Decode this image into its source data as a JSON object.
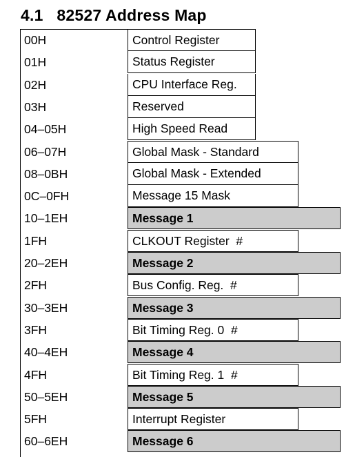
{
  "section": {
    "number": "4.1",
    "title": "82527 Address Map"
  },
  "rows": [
    {
      "address": "00H",
      "name": "Control Register",
      "kind": "narrow"
    },
    {
      "address": "01H",
      "name": "Status Register",
      "kind": "narrow"
    },
    {
      "address": "02H",
      "name": "CPU Interface Reg.",
      "kind": "narrow"
    },
    {
      "address": "03H",
      "name": "Reserved",
      "kind": "narrow"
    },
    {
      "address": "04–05H",
      "name": "High Speed Read",
      "kind": "narrow"
    },
    {
      "address": "06–07H",
      "name": "Global Mask - Standard",
      "kind": "medium"
    },
    {
      "address": "08–0BH",
      "name": "Global Mask - Extended",
      "kind": "medium"
    },
    {
      "address": "0C–0FH",
      "name": "Message 15 Mask",
      "kind": "medium"
    },
    {
      "address": "10–1EH",
      "name": "Message 1",
      "kind": "message"
    },
    {
      "address": "1FH",
      "name": "CLKOUT Register  #",
      "kind": "medium"
    },
    {
      "address": "20–2EH",
      "name": "Message 2",
      "kind": "message"
    },
    {
      "address": "2FH",
      "name": "Bus Config. Reg.  #",
      "kind": "medium"
    },
    {
      "address": "30–3EH",
      "name": "Message 3",
      "kind": "message"
    },
    {
      "address": "3FH",
      "name": "Bit Timing Reg. 0  #",
      "kind": "medium"
    },
    {
      "address": "40–4EH",
      "name": "Message 4",
      "kind": "message"
    },
    {
      "address": "4FH",
      "name": "Bit Timing Reg. 1  #",
      "kind": "medium"
    },
    {
      "address": "50–5EH",
      "name": "Message 5",
      "kind": "message"
    },
    {
      "address": "5FH",
      "name": "Interrupt Register",
      "kind": "medium"
    },
    {
      "address": "60–6EH",
      "name": "Message 6",
      "kind": "message"
    }
  ],
  "colors": {
    "message_fill": "#cccccc"
  }
}
